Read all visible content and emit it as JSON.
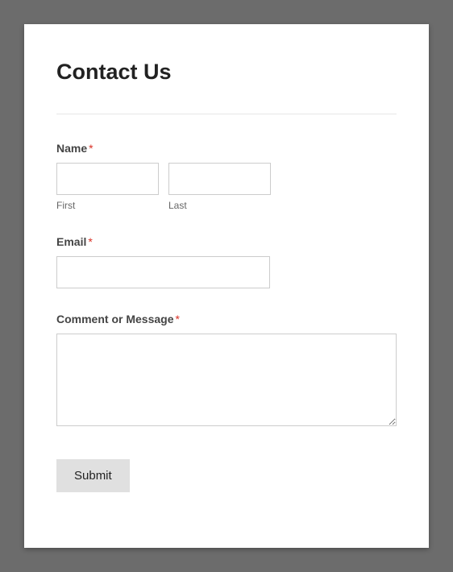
{
  "page": {
    "title": "Contact Us"
  },
  "form": {
    "fields": {
      "name": {
        "label": "Name",
        "required_marker": "*",
        "first": {
          "sublabel": "First",
          "value": ""
        },
        "last": {
          "sublabel": "Last",
          "value": ""
        }
      },
      "email": {
        "label": "Email",
        "required_marker": "*",
        "value": ""
      },
      "message": {
        "label": "Comment or Message",
        "required_marker": "*",
        "value": ""
      }
    },
    "submit": {
      "label": "Submit"
    }
  }
}
